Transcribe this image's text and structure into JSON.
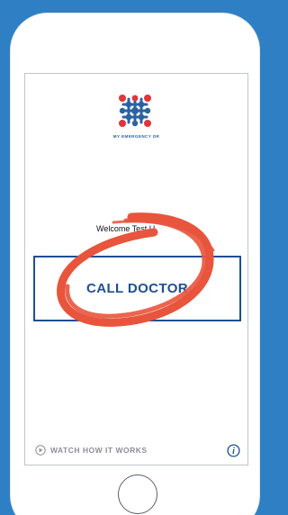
{
  "app": {
    "brand_name": "MY EMERGENCY DR"
  },
  "main": {
    "welcome_text": "Welcome Test U",
    "call_button_label": "CALL DOCTOR"
  },
  "footer": {
    "watch_label": "WATCH HOW IT WORKS",
    "info_icon": "info-icon",
    "play_icon": "play-circle-icon"
  },
  "colors": {
    "background": "#2f7fc4",
    "brand_blue": "#1f4f92",
    "logo_red": "#e0353b",
    "scribble_red": "#e8543c"
  }
}
